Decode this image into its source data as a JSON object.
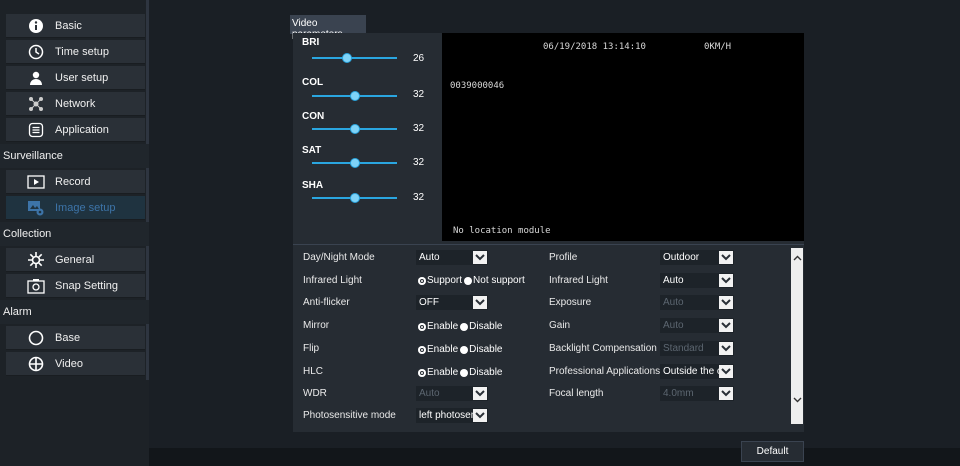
{
  "sidebar": {
    "items": [
      {
        "label": "Basic",
        "icon": "info-icon"
      },
      {
        "label": "Time setup",
        "icon": "clock-icon"
      },
      {
        "label": "User setup",
        "icon": "user-icon"
      },
      {
        "label": "Network",
        "icon": "network-icon"
      },
      {
        "label": "Application",
        "icon": "application-icon"
      }
    ],
    "surveillance": {
      "title": "Surveillance",
      "items": [
        {
          "label": "Record",
          "icon": "record-icon"
        },
        {
          "label": "Image setup",
          "icon": "image-setup-icon",
          "active": true
        }
      ]
    },
    "collection": {
      "title": "Collection",
      "items": [
        {
          "label": "General",
          "icon": "gear-icon"
        },
        {
          "label": "Snap Setting",
          "icon": "camera-icon"
        }
      ]
    },
    "alarm": {
      "title": "Alarm",
      "items": [
        {
          "label": "Base",
          "icon": "circle-icon"
        },
        {
          "label": "Video",
          "icon": "video-icon"
        }
      ]
    }
  },
  "tab": {
    "label": "Video parameters"
  },
  "sliders": [
    {
      "label": "BRI",
      "value": "26",
      "level": 0.41
    },
    {
      "label": "COL",
      "value": "32",
      "level": 0.5
    },
    {
      "label": "CON",
      "value": "32",
      "level": 0.5
    },
    {
      "label": "SAT",
      "value": "32",
      "level": 0.5
    },
    {
      "label": "SHA",
      "value": "32",
      "level": 0.5
    }
  ],
  "video_overlay": {
    "datetime": "06/19/2018 13:14:10",
    "speed": "0KM/H",
    "device_id": "0039000046",
    "location": "No location module"
  },
  "settings": {
    "day_night_mode": {
      "label": "Day/Night Mode",
      "value": "Auto"
    },
    "infrared_light_left": {
      "label": "Infrared Light",
      "opt1": "Support",
      "opt2": "Not support"
    },
    "anti_flicker": {
      "label": "Anti-flicker",
      "value": "OFF"
    },
    "mirror": {
      "label": "Mirror",
      "opt1": "Enable",
      "opt2": "Disable"
    },
    "flip": {
      "label": "Flip",
      "opt1": "Enable",
      "opt2": "Disable"
    },
    "hlc": {
      "label": "HLC",
      "opt1": "Enable",
      "opt2": "Disable"
    },
    "wdr": {
      "label": "WDR",
      "value": "Auto"
    },
    "photosensitive_mode": {
      "label": "Photosensitive mode",
      "value": "left photosen"
    },
    "profile": {
      "label": "Profile",
      "value": "Outdoor"
    },
    "infrared_light_right": {
      "label": "Infrared Light",
      "value": "Auto"
    },
    "exposure": {
      "label": "Exposure",
      "value": "Auto"
    },
    "gain": {
      "label": "Gain",
      "value": "Auto"
    },
    "backlight": {
      "label": "Backlight Compensation",
      "value": "Standard"
    },
    "professional": {
      "label": "Professional Applications",
      "value": "Outside the c"
    },
    "focal_length": {
      "label": "Focal length",
      "value": "4.0mm"
    }
  },
  "footer": {
    "default_label": "Default"
  },
  "colors": {
    "accent": "#2aa6e0",
    "active_text": "#3d74a8",
    "background": "#1a1f25"
  }
}
